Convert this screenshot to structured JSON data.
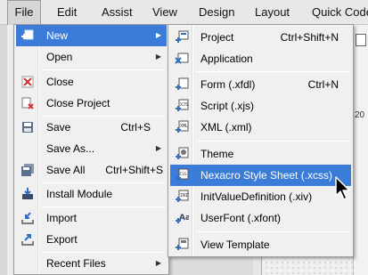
{
  "menubar": {
    "items": [
      {
        "label": "File",
        "active": true
      },
      {
        "label": "Edit"
      },
      {
        "label": "Assist"
      },
      {
        "label": "View"
      },
      {
        "label": "Design"
      },
      {
        "label": "Layout"
      },
      {
        "label": "Quick Code"
      }
    ]
  },
  "background": {
    "left_letter": "F",
    "right_number": "20"
  },
  "file_menu": {
    "items": [
      {
        "label": "New",
        "has_submenu": true,
        "highlighted": true,
        "icon": "new-file-icon"
      },
      {
        "label": "Open",
        "has_submenu": true,
        "icon": ""
      },
      {
        "label": "Close",
        "icon": "close-red-x-icon"
      },
      {
        "label": "Close Project",
        "icon": "close-project-icon"
      },
      {
        "label": "Save",
        "shortcut": "Ctrl+S",
        "icon": "save-disk-icon"
      },
      {
        "label": "Save As...",
        "has_submenu": true,
        "icon": ""
      },
      {
        "label": "Save All",
        "shortcut": "Ctrl+Shift+S",
        "icon": "save-all-icon"
      },
      {
        "label": "Install Module",
        "icon": "install-module-icon"
      },
      {
        "label": "Import",
        "icon": "import-icon"
      },
      {
        "label": "Export",
        "icon": "export-icon"
      },
      {
        "label": "Recent Files",
        "has_submenu": true,
        "icon": ""
      }
    ]
  },
  "new_menu": {
    "items": [
      {
        "label": "Project",
        "shortcut": "Ctrl+Shift+N",
        "icon": "project-icon"
      },
      {
        "label": "Application",
        "shortcut": "",
        "icon": "application-icon"
      },
      {
        "label": "Form (.xfdl)",
        "shortcut": "Ctrl+N",
        "icon": "form-icon"
      },
      {
        "label": "Script (.xjs)",
        "shortcut": "",
        "icon": "script-icon"
      },
      {
        "label": "XML (.xml)",
        "shortcut": "",
        "icon": "xml-icon"
      },
      {
        "label": "Theme",
        "shortcut": "",
        "icon": "theme-icon"
      },
      {
        "label": "Nexacro Style Sheet (.xcss)",
        "shortcut": "",
        "icon": "xcss-icon",
        "highlighted": true
      },
      {
        "label": "InitValueDefinition (.xiv)",
        "shortcut": "",
        "icon": "xiv-icon"
      },
      {
        "label": "UserFont (.xfont)",
        "shortcut": "",
        "icon": "userfont-icon"
      },
      {
        "label": "View Template",
        "shortcut": "",
        "icon": "view-template-icon"
      }
    ]
  },
  "colors": {
    "highlight": "#3b7cd9",
    "menu_bg": "#f0f0f0",
    "icon_blue": "#2f6fc0",
    "icon_red": "#d03030"
  }
}
